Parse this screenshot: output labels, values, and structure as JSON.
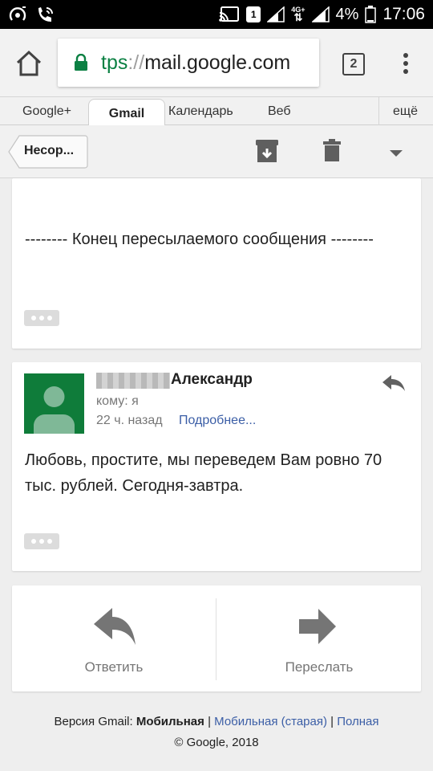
{
  "status_bar": {
    "sim_badge": "1",
    "net_type": "4G+",
    "net_sub": "4G",
    "battery": "4%",
    "time": "17:06"
  },
  "browser": {
    "url_scheme": "tps",
    "url_sep": "://",
    "url_host": "mail.google.com",
    "tab_count": "2"
  },
  "google_nav": {
    "items": [
      "Google+",
      "Gmail",
      "Календарь",
      "Веб"
    ],
    "more": "ещё"
  },
  "toolbar": {
    "back_label": "Несор..."
  },
  "forward_card": {
    "text": "-------- Конец пересылаемого сообщения --------"
  },
  "message": {
    "sender": "Александр",
    "to": "кому: я",
    "time": "22 ч. назад",
    "details": "Подробнее...",
    "body": "Любовь, простите, мы переведем Вам ровно 70 тыс. рублей. Сегодня-завтра."
  },
  "actions": {
    "reply": "Ответить",
    "forward": "Переслать"
  },
  "footer": {
    "version_label": "Версия Gmail:",
    "mobile": "Мобильная",
    "sep": "|",
    "mobile_old": "Мобильная (старая)",
    "full": "Полная",
    "copyright": "© Google, 2018"
  },
  "colors": {
    "avatar": "#0f7c3a",
    "link": "#3b5ea6",
    "secure": "#0b8043"
  }
}
